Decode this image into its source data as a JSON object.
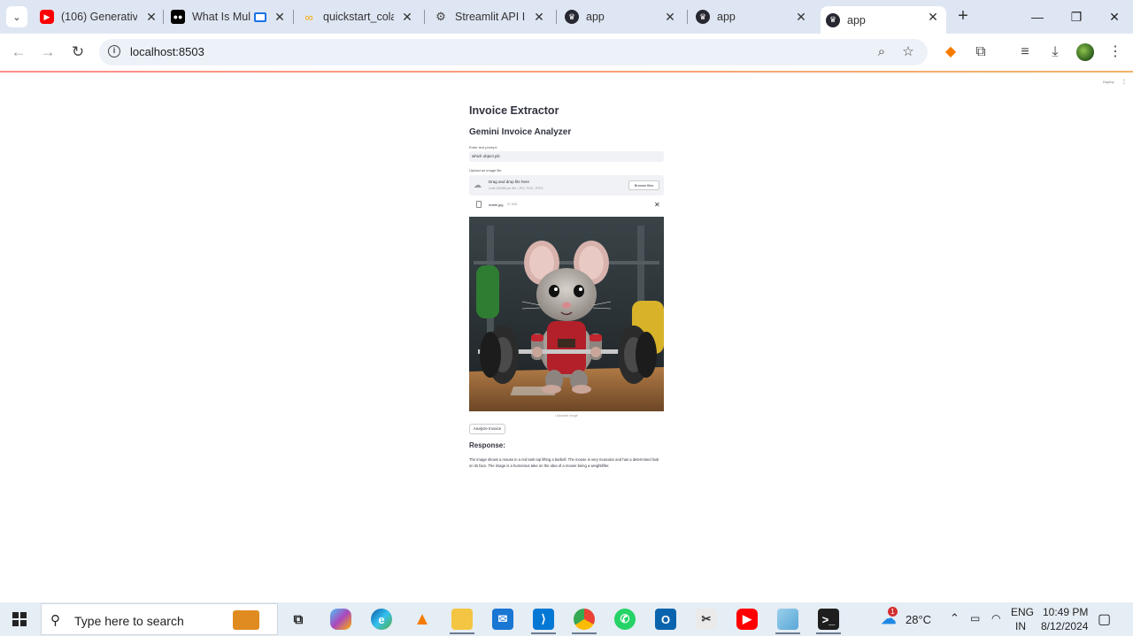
{
  "browser": {
    "tabs": [
      {
        "title": "(106) Generative",
        "icon": "youtube-icon",
        "color": "#ff0000"
      },
      {
        "title": "What Is Mult",
        "icon": "medium-icon",
        "color": "#000000"
      },
      {
        "title": "quickstart_colab",
        "icon": "colab-icon",
        "color": "#f9ab00"
      },
      {
        "title": "Streamlit API Int",
        "icon": "openai-icon",
        "color": "#444444"
      },
      {
        "title": "app",
        "icon": "streamlit-crown-icon",
        "color": "#262730"
      },
      {
        "title": "app",
        "icon": "streamlit-crown-icon",
        "color": "#262730"
      },
      {
        "title": "app",
        "icon": "streamlit-crown-icon",
        "color": "#262730"
      }
    ],
    "url": "localhost:8503"
  },
  "app": {
    "header_deploy": "Deploy",
    "title": "Invoice Extractor",
    "subheader": "Gemini Invoice Analyzer",
    "prompt_label": "Enter text prompt:",
    "prompt_value": "which object plz",
    "upload_label": "Upload an image file",
    "drag_text": "Drag and drop file here",
    "limit_text": "Limit 200MB per file • JPG, PNG, JPEG",
    "browse_button": "Browse files",
    "file_name": "matte.jpg",
    "file_size": "97.5KB",
    "image_caption": "Uploaded image",
    "analyze_button": "Analyze Invoice",
    "response_heading": "Response:",
    "response_text": "The image shows a mouse in a red tank top lifting a barbell. The mouse is very muscular and has a determined look on its face. The image is a humorous take on the idea of a mouse being a weightlifter."
  },
  "taskbar": {
    "search_placeholder": "Type here to search",
    "weather_temp": "28°C",
    "weather_badge": "1",
    "lang_top": "ENG",
    "lang_bottom": "IN",
    "time": "10:49 PM",
    "date": "8/12/2024"
  }
}
